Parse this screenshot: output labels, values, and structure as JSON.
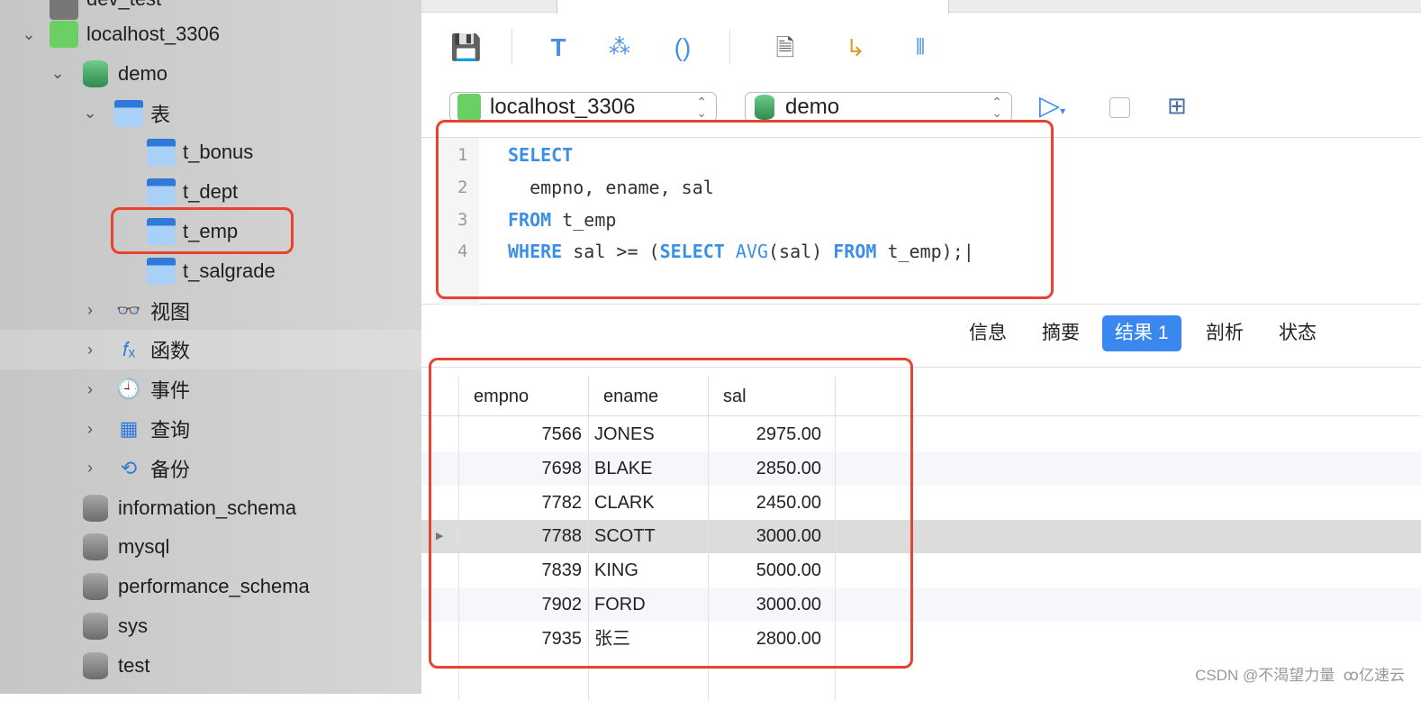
{
  "sidebar": {
    "top_partial": "dev_test",
    "items": [
      {
        "label": "localhost_3306",
        "level": 0,
        "chevron": "down",
        "icon": "mysql-connection-icon"
      },
      {
        "label": "demo",
        "level": 1,
        "chevron": "down",
        "icon": "database-icon"
      },
      {
        "label": "表",
        "level": 2,
        "chevron": "down",
        "icon": "tables-icon"
      },
      {
        "label": "t_bonus",
        "level": 3,
        "icon": "table-icon"
      },
      {
        "label": "t_dept",
        "level": 3,
        "icon": "table-icon"
      },
      {
        "label": "t_emp",
        "level": 3,
        "icon": "table-icon",
        "highlighted": true
      },
      {
        "label": "t_salgrade",
        "level": 3,
        "icon": "table-icon"
      },
      {
        "label": "视图",
        "level": 2,
        "chevron": "right",
        "icon": "view-icon"
      },
      {
        "label": "函数",
        "level": 2,
        "chevron": "right",
        "icon": "function-icon",
        "selected": true
      },
      {
        "label": "事件",
        "level": 2,
        "chevron": "right",
        "icon": "event-clock-icon"
      },
      {
        "label": "查询",
        "level": 2,
        "chevron": "right",
        "icon": "query-icon"
      },
      {
        "label": "备份",
        "level": 2,
        "chevron": "right",
        "icon": "backup-icon"
      },
      {
        "label": "information_schema",
        "level": 1,
        "icon": "database-icon"
      },
      {
        "label": "mysql",
        "level": 1,
        "icon": "database-icon"
      },
      {
        "label": "performance_schema",
        "level": 1,
        "icon": "database-icon"
      },
      {
        "label": "sys",
        "level": 1,
        "icon": "database-icon"
      },
      {
        "label": "test",
        "level": 1,
        "icon": "database-icon"
      }
    ]
  },
  "toolbar": {
    "icons": [
      "save-icon",
      "format-icon",
      "beautify-wand-icon",
      "parentheses-icon",
      "text-document-icon",
      "export-icon",
      "explain-chart-icon"
    ]
  },
  "selectors": {
    "connection": "localhost_3306",
    "database": "demo"
  },
  "editor": {
    "lines": [
      "1",
      "2",
      "3",
      "4"
    ]
  },
  "result_tabs": [
    {
      "label": "信息"
    },
    {
      "label": "摘要"
    },
    {
      "label": "结果 1",
      "active": true
    },
    {
      "label": "剖析"
    },
    {
      "label": "状态"
    }
  ],
  "grid": {
    "columns": [
      "empno",
      "ename",
      "sal"
    ],
    "rows": [
      [
        "7566",
        "JONES",
        "2975.00"
      ],
      [
        "7698",
        "BLAKE",
        "2850.00"
      ],
      [
        "7782",
        "CLARK",
        "2450.00"
      ],
      [
        "7788",
        "SCOTT",
        "3000.00"
      ],
      [
        "7839",
        "KING",
        "5000.00"
      ],
      [
        "7902",
        "FORD",
        "3000.00"
      ],
      [
        "7935",
        "张三",
        "2800.00"
      ]
    ],
    "current_row": 3
  },
  "watermark": {
    "csdn": "CSDN @不渴望力量",
    "yisu": "亿速云"
  },
  "colors": {
    "accent": "#3b87f0",
    "highlight_box": "#e8432e",
    "keyword": "#3b8fe6"
  }
}
